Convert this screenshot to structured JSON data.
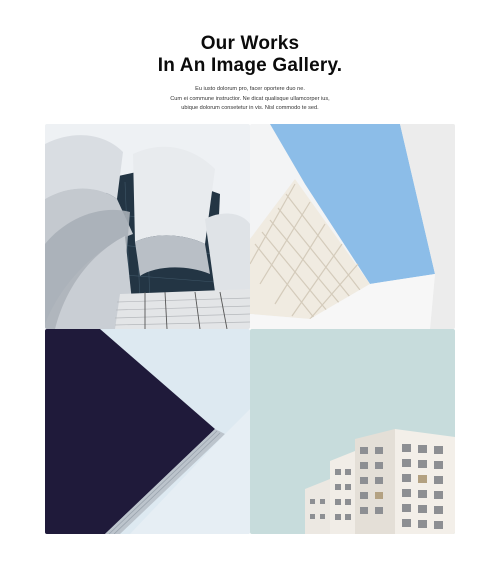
{
  "header": {
    "title_line1": "Our Works",
    "title_line2": "In An Image Gallery.",
    "description": [
      "Eu iusto dolorum pro, facer oportere duo ne.",
      "Cum ei commune instructior. Ne dicat qualisque ullamcorper ius,",
      "ubique dolorum consetetur in vis. Nisl commodo te sed."
    ]
  },
  "gallery": {
    "images": [
      {
        "subject": "curved-metal-concert-hall-photo"
      },
      {
        "subject": "white-building-blue-sky-photo"
      },
      {
        "subject": "dark-angular-facade-photo"
      },
      {
        "subject": "apartment-block-pale-sky-photo"
      }
    ]
  },
  "colors": {
    "title": "#0b0b0b",
    "sky_blue": "#8cbde8",
    "navy": "#1f1a3a",
    "pale_teal": "#c7dcdc"
  }
}
